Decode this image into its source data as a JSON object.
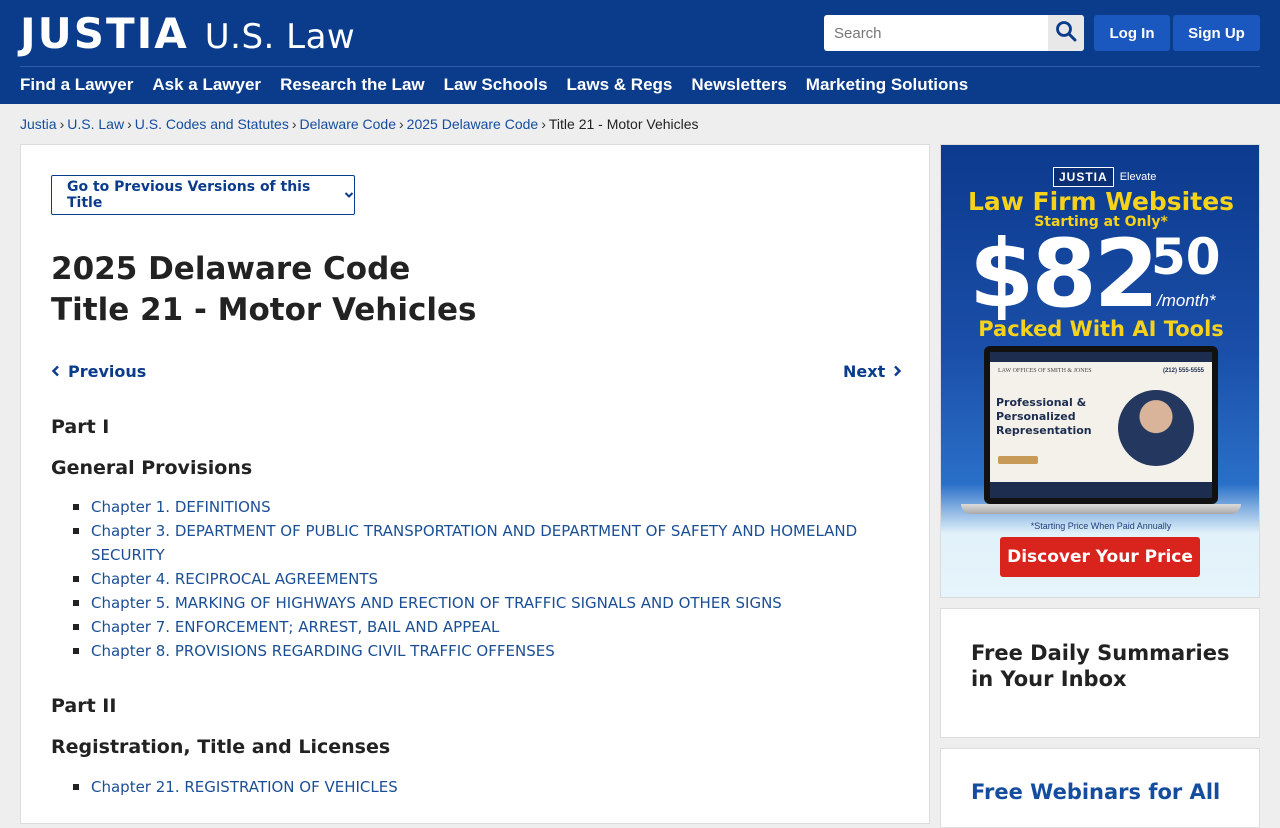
{
  "header": {
    "logo": "JUSTIA",
    "logo_sub": "U.S. Law",
    "search_placeholder": "Search",
    "login": "Log In",
    "signup": "Sign Up",
    "nav": [
      "Find a Lawyer",
      "Ask a Lawyer",
      "Research the Law",
      "Law Schools",
      "Laws & Regs",
      "Newsletters",
      "Marketing Solutions"
    ]
  },
  "breadcrumb": {
    "items": [
      "Justia",
      "U.S. Law",
      "U.S. Codes and Statutes",
      "Delaware Code",
      "2025 Delaware Code"
    ],
    "current": "Title 21 - Motor Vehicles"
  },
  "main": {
    "versions_button": "Go to Previous Versions of this Title",
    "title_line1": "2025 Delaware Code",
    "title_line2": "Title 21 - Motor Vehicles",
    "previous": "Previous",
    "next": "Next",
    "parts": [
      {
        "part": "Part I",
        "name": "General Provisions",
        "chapters": [
          "Chapter 1. DEFINITIONS",
          "Chapter 3. DEPARTMENT OF PUBLIC TRANSPORTATION AND DEPARTMENT OF SAFETY AND HOMELAND SECURITY",
          "Chapter 4. RECIPROCAL AGREEMENTS",
          "Chapter 5. MARKING OF HIGHWAYS AND ERECTION OF TRAFFIC SIGNALS AND OTHER SIGNS",
          "Chapter 7. ENFORCEMENT; ARREST, BAIL AND APPEAL",
          "Chapter 8. PROVISIONS REGARDING CIVIL TRAFFIC OFFENSES"
        ]
      },
      {
        "part": "Part II",
        "name": "Registration, Title and Licenses",
        "chapters": [
          "Chapter 21. REGISTRATION OF VEHICLES"
        ]
      }
    ]
  },
  "sidebar": {
    "ad": {
      "brand": "JUSTIA",
      "brand_sub": "Elevate",
      "headline": "Law Firm Websites",
      "subhead": "Starting at Only*",
      "price": "$82",
      "cents": "50",
      "per": "/month*",
      "tagline": "Packed With AI Tools",
      "laptop_firm": "LAW OFFICES OF SMITH & JONES",
      "laptop_phone": "(212) 555-5555",
      "laptop_text": "Professional & Personalized Representation",
      "note": "*Starting Price When Paid Annually",
      "cta": "Discover Your Price"
    },
    "card1_title": "Free Daily Summaries in Your Inbox",
    "card2_title": "Free Webinars for All"
  },
  "colors": {
    "header_bg": "#0b3c8c",
    "link": "#154d9e",
    "button": "#1a58c0",
    "ad_cta": "#d9231d",
    "ad_yellow": "#f6d21a"
  },
  "icons": [
    "search-icon",
    "chevron-down-icon",
    "chevron-left-icon",
    "chevron-right-icon"
  ]
}
